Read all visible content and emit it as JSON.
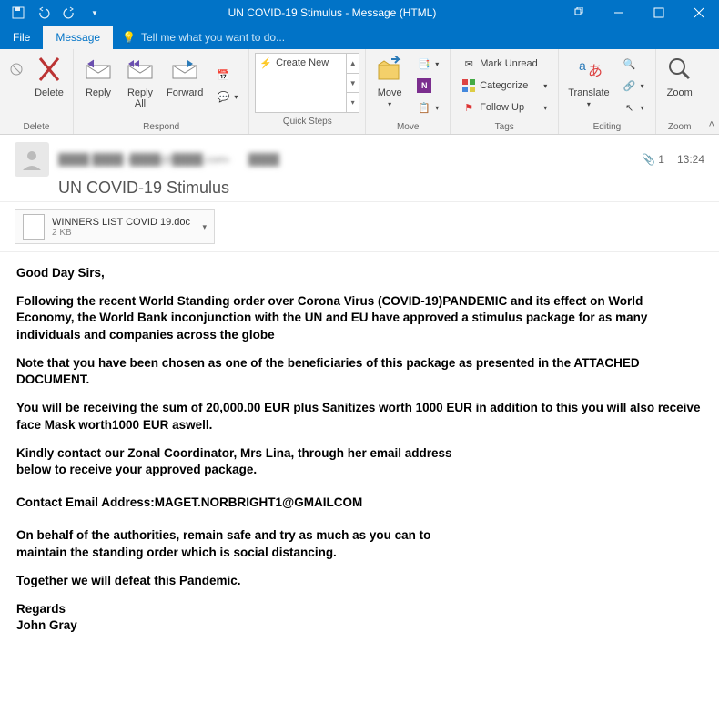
{
  "window": {
    "title": "UN COVID-19 Stimulus - Message (HTML)"
  },
  "tabs": {
    "file": "File",
    "message": "Message",
    "tellme": "Tell me what you want to do..."
  },
  "ribbon": {
    "delete_group": "Delete",
    "delete": "Delete",
    "respond_group": "Respond",
    "reply": "Reply",
    "reply_all": "Reply\nAll",
    "forward": "Forward",
    "quicksteps_group": "Quick Steps",
    "create_new": "Create New",
    "move_group": "Move",
    "move": "Move",
    "tags_group": "Tags",
    "mark_unread": "Mark Unread",
    "categorize": "Categorize",
    "follow_up": "Follow Up",
    "editing_group": "Editing",
    "translate": "Translate",
    "zoom_group": "Zoom",
    "zoom": "Zoom"
  },
  "header": {
    "subject": "UN COVID-19 Stimulus",
    "attach_count": "1",
    "time": "13:24"
  },
  "attachment": {
    "name": "WINNERS LIST COVID 19.doc",
    "size": "2 KB"
  },
  "email": {
    "p1": "Good Day Sirs,",
    "p2": "Following the recent World Standing order over Corona Virus (COVID-19)PANDEMIC and its effect on World Economy, the World Bank inconjunction with the UN and EU have approved a stimulus package for as many individuals and companies across the globe",
    "p3": "Note that you have been chosen as one of the beneficiaries of this package as presented in the ATTACHED DOCUMENT.",
    "p4": "You will be receiving the sum of 20,000.00 EUR plus Sanitizes worth 1000 EUR in addition to this you will also receive face Mask worth1000 EUR aswell.",
    "p5a": "Kindly contact our Zonal Coordinator, Mrs Lina, through her email address",
    "p5b": "below to receive your approved package.",
    "p6": "Contact Email Address:MAGET.NORBRIGHT1@GMAILCOM",
    "p7a": "On behalf of the authorities, remain safe and try as much as you can to",
    "p7b": "maintain the standing order which is social distancing.",
    "p8": "Together we will defeat this Pandemic.",
    "p9a": "Regards",
    "p9b": "John Gray"
  }
}
